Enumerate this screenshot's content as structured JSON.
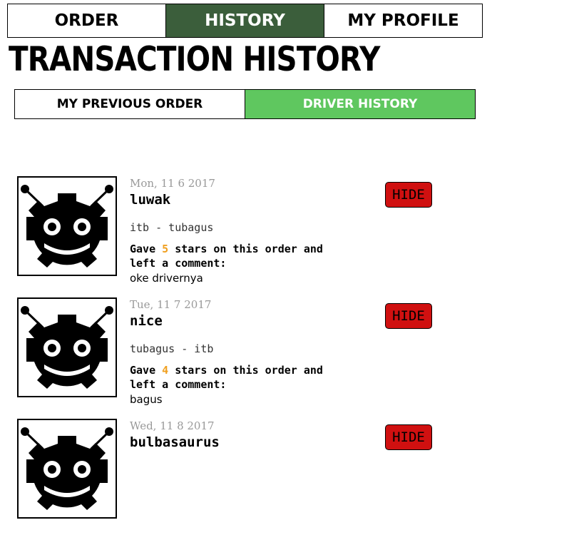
{
  "nav": {
    "tabs": [
      {
        "label": "ORDER",
        "active": false
      },
      {
        "label": "HISTORY",
        "active": true
      },
      {
        "label": "MY PROFILE",
        "active": false
      }
    ]
  },
  "page_title": "TRANSACTION HISTORY",
  "subnav": {
    "tabs": [
      {
        "label": "MY PREVIOUS ORDER",
        "active": false
      },
      {
        "label": "DRIVER HISTORY",
        "active": true
      }
    ]
  },
  "history": {
    "entries": [
      {
        "date": "Mon, 11 6 2017",
        "name": "luwak",
        "route": "itb - tubagus",
        "rating_prefix": "Gave",
        "stars": "5",
        "rating_suffix": "stars on this order and left a comment:",
        "comment": "oke drivernya",
        "hide_label": "HIDE",
        "avatar_icon": "robot-gear-icon"
      },
      {
        "date": "Tue, 11 7 2017",
        "name": "nice",
        "route": "tubagus - itb",
        "rating_prefix": "Gave",
        "stars": "4",
        "rating_suffix": "stars on this order and left a comment:",
        "comment": "bagus",
        "hide_label": "HIDE",
        "avatar_icon": "robot-gear-icon"
      },
      {
        "date": "Wed, 11 8 2017",
        "name": "bulbasaurus",
        "hide_label": "HIDE",
        "avatar_icon": "robot-gear-icon"
      }
    ]
  },
  "colors": {
    "nav_active": "#3b5e3b",
    "subnav_active": "#5fc75f",
    "hide_button": "#d01010",
    "star_count": "#f0a020",
    "date_text": "#999999"
  }
}
